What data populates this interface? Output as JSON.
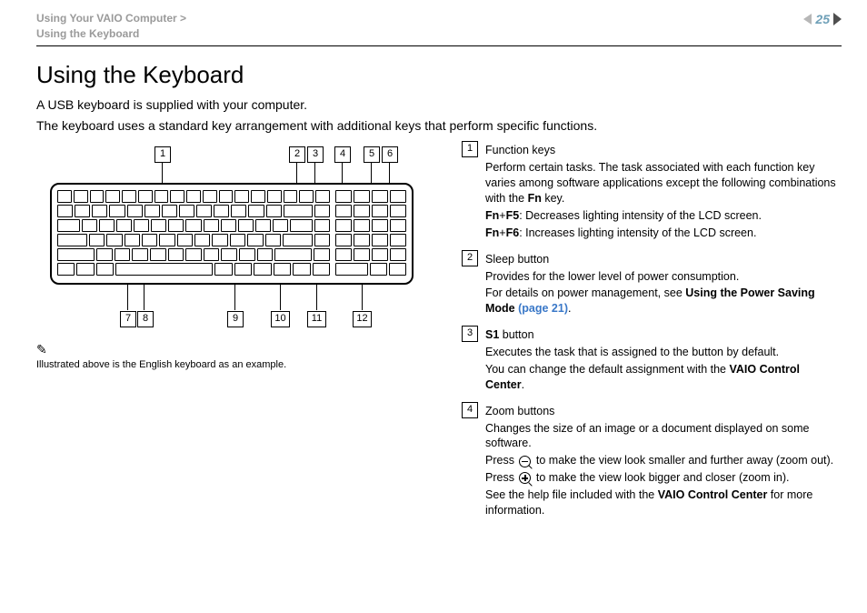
{
  "header": {
    "breadcrumb_line1": "Using Your VAIO Computer >",
    "breadcrumb_line2": "Using the Keyboard",
    "page_number": "25"
  },
  "title": "Using the Keyboard",
  "intro": {
    "p1": "A USB keyboard is supplied with your computer.",
    "p2": "The keyboard uses a standard key arrangement with additional keys that perform specific functions."
  },
  "figure": {
    "top_labels": [
      "1",
      "2",
      "3",
      "4",
      "5",
      "6"
    ],
    "bottom_labels": [
      "7",
      "8",
      "9",
      "10",
      "11",
      "12"
    ],
    "caption": "Illustrated above is the English keyboard as an example."
  },
  "legend": {
    "i1": {
      "num": "1",
      "title": "Function keys",
      "p1": "Perform certain tasks. The task associated with each function key varies among software applications except the following combinations with the ",
      "fn": "Fn",
      "p1b": " key.",
      "l1a": "Fn",
      "l1b": "+",
      "l1c": "F5",
      "l1d": ": Decreases lighting intensity of the LCD screen.",
      "l2a": "Fn",
      "l2b": "+",
      "l2c": "F6",
      "l2d": ": Increases lighting intensity of the LCD screen."
    },
    "i2": {
      "num": "2",
      "title": "Sleep button",
      "p1": "Provides for the lower level of power consumption.",
      "p2a": "For details on power management, see ",
      "p2b": "Using the Power Saving Mode ",
      "link": "(page 21)",
      "p2c": "."
    },
    "i3": {
      "num": "3",
      "titlebold": "S1",
      "titlerest": " button",
      "p1": "Executes the task that is assigned to the button by default.",
      "p2a": "You can change the default assignment with the ",
      "p2b": "VAIO Control Center",
      "p2c": "."
    },
    "i4": {
      "num": "4",
      "title": "Zoom buttons",
      "p1": "Changes the size of an image or a document displayed on some software.",
      "p2a": "Press ",
      "p2b": " to make the view look smaller and further away (zoom out).",
      "p3a": "Press ",
      "p3b": " to make the view look bigger and closer (zoom in).",
      "p4a": "See the help file included with the ",
      "p4b": "VAIO Control Center",
      "p4c": " for more information."
    }
  }
}
